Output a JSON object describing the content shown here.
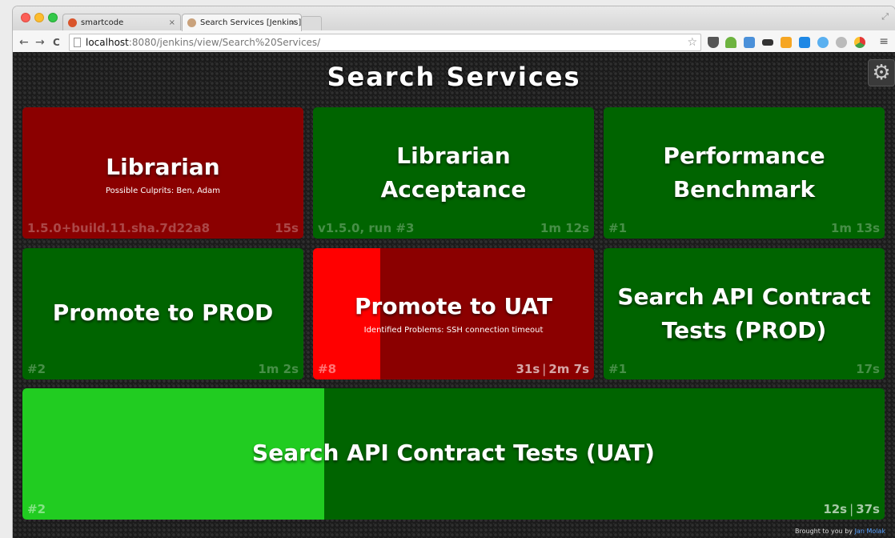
{
  "browser": {
    "tabs": [
      {
        "label": "smartcode",
        "close": "×"
      },
      {
        "label": "Search Services [Jenkins]",
        "close": "×"
      }
    ],
    "nav": {
      "back": "←",
      "forward": "→",
      "reload": "C"
    },
    "address": {
      "host": "localhost",
      "rest": ":8080/jenkins/view/Search%20Services/"
    },
    "icons": [
      "star-icon",
      "pocket-icon",
      "tree-icon",
      "translate-icon",
      "glasses-icon",
      "jb-icon",
      "check-icon",
      "puzzle-icon",
      "shield-icon",
      "chrome-icon",
      "menu-icon"
    ]
  },
  "dashboard": {
    "title": "Search Services",
    "settings_icon": "gear-icon",
    "credit_prefix": "Brought to you by",
    "credit_author": "Jan Molak"
  },
  "jobs": [
    {
      "name": "Librarian",
      "detail": "Possible Culprits: Ben,  Adam",
      "build": "1.5.0+build.11.sha.7d22a8",
      "duration": "15s",
      "status": "failed"
    },
    {
      "name_line1": "Librarian",
      "name_line2": "Acceptance",
      "build": "v1.5.0, run #3",
      "duration": "1m 12s",
      "status": "success"
    },
    {
      "name_line1": "Performance",
      "name_line2": "Benchmark",
      "build": "#1",
      "duration": "1m 13s",
      "status": "success"
    },
    {
      "name": "Promote to PROD",
      "build": "#2",
      "duration": "1m 2s",
      "status": "success"
    },
    {
      "name": "Promote to UAT",
      "detail": "Identified Problems: SSH connection timeout",
      "build": "#8",
      "duration_elapsed": "31s",
      "duration_separator": "|",
      "duration_expected": "2m 7s",
      "status": "failed",
      "progress": 0.24
    },
    {
      "name_line1": "Search API Contract",
      "name_line2": "Tests (PROD)",
      "build": "#1",
      "duration": "17s",
      "status": "success"
    },
    {
      "name": "Search API Contract Tests (UAT)",
      "build": "#2",
      "duration_elapsed": "12s",
      "duration_separator": "|",
      "duration_expected": "37s",
      "status": "success",
      "progress": 0.35
    }
  ],
  "colors": {
    "success": "#006400",
    "failed": "#8b0000",
    "failed_building": "#ff0000",
    "success_building": "#21cc21"
  }
}
